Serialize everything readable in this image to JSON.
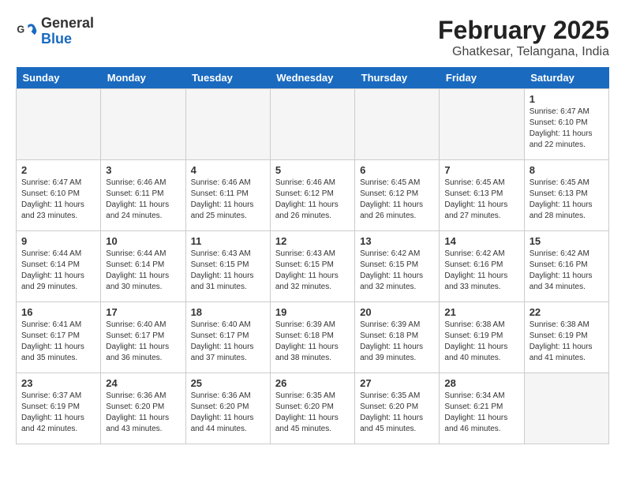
{
  "header": {
    "logo_line1": "General",
    "logo_line2": "Blue",
    "month": "February 2025",
    "location": "Ghatkesar, Telangana, India"
  },
  "days_of_week": [
    "Sunday",
    "Monday",
    "Tuesday",
    "Wednesday",
    "Thursday",
    "Friday",
    "Saturday"
  ],
  "weeks": [
    [
      {
        "day": "",
        "empty": true
      },
      {
        "day": "",
        "empty": true
      },
      {
        "day": "",
        "empty": true
      },
      {
        "day": "",
        "empty": true
      },
      {
        "day": "",
        "empty": true
      },
      {
        "day": "",
        "empty": true
      },
      {
        "day": "1",
        "sunrise": "6:47 AM",
        "sunset": "6:10 PM",
        "daylight": "11 hours and 22 minutes."
      }
    ],
    [
      {
        "day": "2",
        "sunrise": "6:47 AM",
        "sunset": "6:10 PM",
        "daylight": "11 hours and 23 minutes."
      },
      {
        "day": "3",
        "sunrise": "6:46 AM",
        "sunset": "6:11 PM",
        "daylight": "11 hours and 24 minutes."
      },
      {
        "day": "4",
        "sunrise": "6:46 AM",
        "sunset": "6:11 PM",
        "daylight": "11 hours and 25 minutes."
      },
      {
        "day": "5",
        "sunrise": "6:46 AM",
        "sunset": "6:12 PM",
        "daylight": "11 hours and 26 minutes."
      },
      {
        "day": "6",
        "sunrise": "6:45 AM",
        "sunset": "6:12 PM",
        "daylight": "11 hours and 26 minutes."
      },
      {
        "day": "7",
        "sunrise": "6:45 AM",
        "sunset": "6:13 PM",
        "daylight": "11 hours and 27 minutes."
      },
      {
        "day": "8",
        "sunrise": "6:45 AM",
        "sunset": "6:13 PM",
        "daylight": "11 hours and 28 minutes."
      }
    ],
    [
      {
        "day": "9",
        "sunrise": "6:44 AM",
        "sunset": "6:14 PM",
        "daylight": "11 hours and 29 minutes."
      },
      {
        "day": "10",
        "sunrise": "6:44 AM",
        "sunset": "6:14 PM",
        "daylight": "11 hours and 30 minutes."
      },
      {
        "day": "11",
        "sunrise": "6:43 AM",
        "sunset": "6:15 PM",
        "daylight": "11 hours and 31 minutes."
      },
      {
        "day": "12",
        "sunrise": "6:43 AM",
        "sunset": "6:15 PM",
        "daylight": "11 hours and 32 minutes."
      },
      {
        "day": "13",
        "sunrise": "6:42 AM",
        "sunset": "6:15 PM",
        "daylight": "11 hours and 32 minutes."
      },
      {
        "day": "14",
        "sunrise": "6:42 AM",
        "sunset": "6:16 PM",
        "daylight": "11 hours and 33 minutes."
      },
      {
        "day": "15",
        "sunrise": "6:42 AM",
        "sunset": "6:16 PM",
        "daylight": "11 hours and 34 minutes."
      }
    ],
    [
      {
        "day": "16",
        "sunrise": "6:41 AM",
        "sunset": "6:17 PM",
        "daylight": "11 hours and 35 minutes."
      },
      {
        "day": "17",
        "sunrise": "6:40 AM",
        "sunset": "6:17 PM",
        "daylight": "11 hours and 36 minutes."
      },
      {
        "day": "18",
        "sunrise": "6:40 AM",
        "sunset": "6:17 PM",
        "daylight": "11 hours and 37 minutes."
      },
      {
        "day": "19",
        "sunrise": "6:39 AM",
        "sunset": "6:18 PM",
        "daylight": "11 hours and 38 minutes."
      },
      {
        "day": "20",
        "sunrise": "6:39 AM",
        "sunset": "6:18 PM",
        "daylight": "11 hours and 39 minutes."
      },
      {
        "day": "21",
        "sunrise": "6:38 AM",
        "sunset": "6:19 PM",
        "daylight": "11 hours and 40 minutes."
      },
      {
        "day": "22",
        "sunrise": "6:38 AM",
        "sunset": "6:19 PM",
        "daylight": "11 hours and 41 minutes."
      }
    ],
    [
      {
        "day": "23",
        "sunrise": "6:37 AM",
        "sunset": "6:19 PM",
        "daylight": "11 hours and 42 minutes."
      },
      {
        "day": "24",
        "sunrise": "6:36 AM",
        "sunset": "6:20 PM",
        "daylight": "11 hours and 43 minutes."
      },
      {
        "day": "25",
        "sunrise": "6:36 AM",
        "sunset": "6:20 PM",
        "daylight": "11 hours and 44 minutes."
      },
      {
        "day": "26",
        "sunrise": "6:35 AM",
        "sunset": "6:20 PM",
        "daylight": "11 hours and 45 minutes."
      },
      {
        "day": "27",
        "sunrise": "6:35 AM",
        "sunset": "6:20 PM",
        "daylight": "11 hours and 45 minutes."
      },
      {
        "day": "28",
        "sunrise": "6:34 AM",
        "sunset": "6:21 PM",
        "daylight": "11 hours and 46 minutes."
      },
      {
        "day": "",
        "empty": true
      }
    ]
  ]
}
